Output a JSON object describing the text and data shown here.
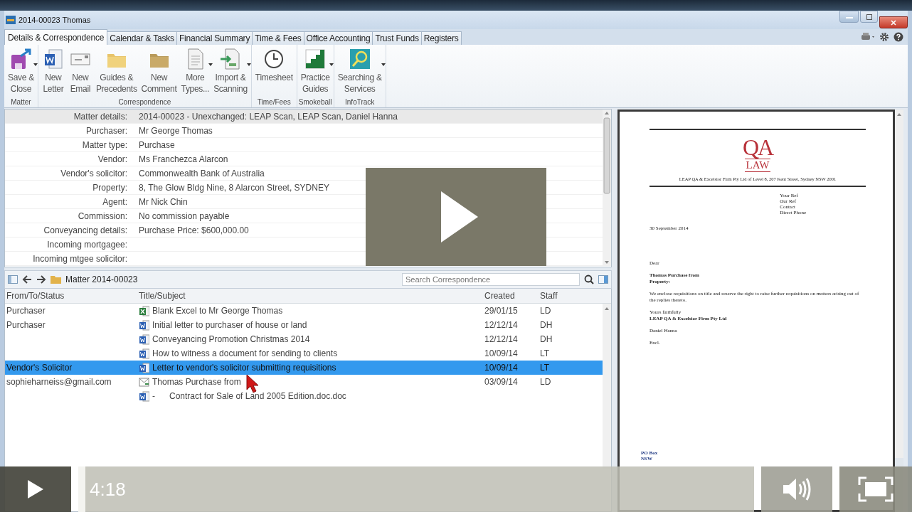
{
  "window": {
    "title": "2014-00023 Thomas"
  },
  "tabs": [
    {
      "label": "Details & Correspondence",
      "selected": true
    },
    {
      "label": "Calendar & Tasks",
      "selected": false
    },
    {
      "label": "Financial Summary",
      "selected": false
    },
    {
      "label": "Time & Fees",
      "selected": false
    },
    {
      "label": "Office Accounting",
      "selected": false
    },
    {
      "label": "Trust Funds",
      "selected": false
    },
    {
      "label": "Registers",
      "selected": false
    }
  ],
  "ribbon": [
    {
      "label": "Matter",
      "buttons": [
        {
          "kind": "save",
          "lines": [
            "Save &",
            "Close"
          ],
          "dropdown": true
        }
      ]
    },
    {
      "label": "Correspondence",
      "buttons": [
        {
          "kind": "word",
          "lines": [
            "New",
            "Letter"
          ],
          "dropdown": false
        },
        {
          "kind": "email",
          "lines": [
            "New",
            "Email"
          ],
          "dropdown": false
        },
        {
          "kind": "folder",
          "lines": [
            "Guides &",
            "Precedents"
          ],
          "dropdown": false
        },
        {
          "kind": "comment",
          "lines": [
            "New",
            "Comment"
          ],
          "dropdown": false
        },
        {
          "kind": "document",
          "lines": [
            "More",
            "Types..."
          ],
          "dropdown": true
        },
        {
          "kind": "import",
          "lines": [
            "Import &",
            "Scanning"
          ],
          "dropdown": true
        }
      ]
    },
    {
      "label": "Time/Fees",
      "buttons": [
        {
          "kind": "clock",
          "lines": [
            "Timesheet"
          ],
          "dropdown": false
        }
      ]
    },
    {
      "label": "Smokeball",
      "buttons": [
        {
          "kind": "stairs",
          "lines": [
            "Practice",
            "Guides"
          ],
          "dropdown": true
        }
      ]
    },
    {
      "label": "InfoTrack",
      "buttons": [
        {
          "kind": "search",
          "lines": [
            "Searching &",
            "Services"
          ],
          "dropdown": true
        }
      ]
    }
  ],
  "details": [
    {
      "label": "Matter details:",
      "value": "2014-00023 - Unexchanged: LEAP Scan, LEAP Scan, Daniel Hanna",
      "selected": true
    },
    {
      "label": "Purchaser:",
      "value": "Mr George Thomas",
      "selected": false
    },
    {
      "label": "Matter type:",
      "value": "Purchase",
      "selected": false
    },
    {
      "label": "Vendor:",
      "value": "Ms Franchezca Alarcon",
      "selected": false
    },
    {
      "label": "Vendor's solicitor:",
      "value": "Commonwealth Bank of Australia",
      "selected": false
    },
    {
      "label": "Property:",
      "value": "8, The Glow Bldg Nine, 8 Alarcon Street, SYDNEY",
      "selected": false
    },
    {
      "label": "Agent:",
      "value": "Mr Nick Chin",
      "selected": false
    },
    {
      "label": "Commission:",
      "value": "No commission payable",
      "selected": false
    },
    {
      "label": "Conveyancing details:",
      "value": "Purchase Price: $600,000.00",
      "selected": false
    },
    {
      "label": "Incoming mortgagee:",
      "selected": false
    },
    {
      "label": "Incoming mtgee solicitor:",
      "selected": false
    }
  ],
  "correspondence": {
    "breadcrumb": "Matter 2014-00023",
    "search": {
      "placeholder": "Search Correspondence"
    },
    "columns": [
      "From/To/Status",
      "Title/Subject",
      "Created",
      "Staff"
    ],
    "rows": [
      {
        "from": "Purchaser",
        "kind": "excel",
        "title": "Blank Excel to Mr George Thomas",
        "created": "29/01/15",
        "staff": "LD",
        "selected": false
      },
      {
        "from": "Purchaser",
        "kind": "word",
        "title": "Initial letter to purchaser of house or land",
        "created": "12/12/14",
        "staff": "DH",
        "selected": false
      },
      {
        "kind": "word",
        "title": "Conveyancing Promotion Christmas 2014",
        "created": "12/12/14",
        "staff": "DH",
        "selected": false
      },
      {
        "kind": "word",
        "title": "How to witness a document for sending to clients",
        "created": "10/09/14",
        "staff": "LT",
        "selected": false
      },
      {
        "from": "Vendor's Solicitor",
        "kind": "word",
        "title": "Letter to vendor's solicitor submitting requisitions",
        "created": "10/09/14",
        "staff": "LT",
        "selected": true
      },
      {
        "from": "sophieharneiss@gmail.com",
        "kind": "email",
        "title": "Thomas Purchase from",
        "created": "03/09/14",
        "staff": "LD",
        "selected": false,
        "children": [
          {
            "kind": "word",
            "marker": "-",
            "title": "Contract for Sale of Land 2005 Edition.doc.doc",
            "selected": false
          }
        ]
      }
    ]
  },
  "preview": {
    "logo": {
      "mark": "QA",
      "sub": "LAW"
    },
    "address": "LEAP QA & Excelsior Firm Pty Ltd of Level 8, 207 Kent Street, Sydney NSW 2001",
    "references": [
      "Your Ref",
      "Our Ref",
      "Contact",
      "Direct Phone"
    ],
    "date": "30 September 2014",
    "salutation": "Dear",
    "subject": [
      "Thomas Purchase from",
      "Property:"
    ],
    "body": "We enclose requisitions on title and reserve the right to raise further requisitions on matters arising out of the replies thereto.",
    "closing": "Yours faithfully",
    "firm": "LEAP QA & Excelsior Firm Pty Ltd",
    "signatory": "Daniel Hanna",
    "enclosure": "Encl.",
    "footer": [
      "PO Box",
      "NSW"
    ]
  },
  "player": {
    "time": "4:18",
    "level": 0.01
  }
}
